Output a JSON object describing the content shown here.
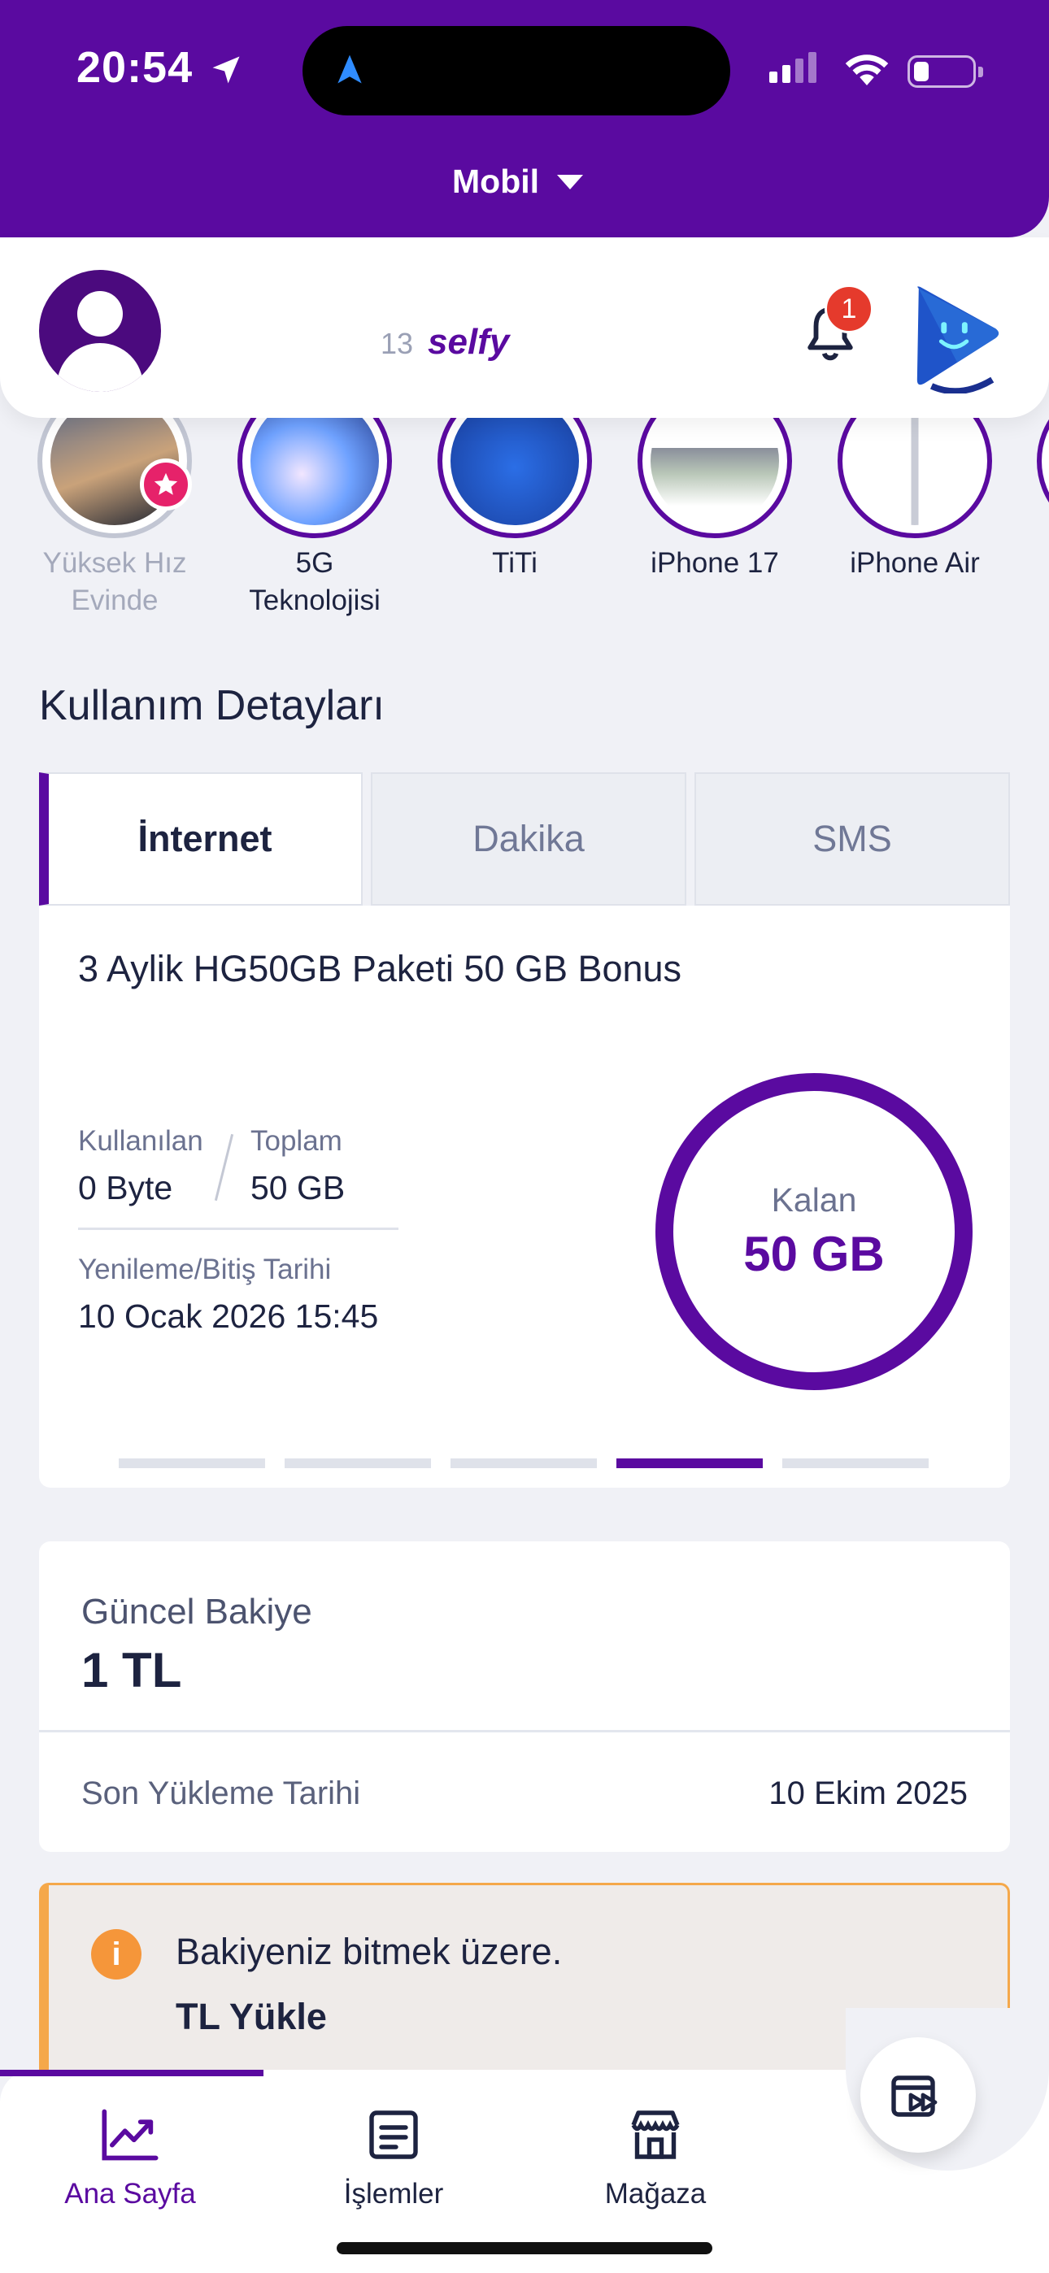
{
  "status_bar": {
    "time": "20:54"
  },
  "header": {
    "line_selector": "Mobil"
  },
  "profile": {
    "name_suffix": "13",
    "brand": "selfy",
    "notification_count": "1"
  },
  "stories": [
    {
      "label": "Yüksek Hız Evinde",
      "seen": true
    },
    {
      "label": "5G Teknolojisi",
      "seen": false
    },
    {
      "label": "TiTi",
      "seen": false
    },
    {
      "label": "iPhone 17",
      "seen": false
    },
    {
      "label": "iPhone Air",
      "seen": false
    }
  ],
  "usage": {
    "title": "Kullanım Detayları",
    "tabs": [
      "İnternet",
      "Dakika",
      "SMS"
    ],
    "active_tab": "İnternet",
    "package_name": "3 Aylik HG50GB Paketi 50 GB Bonus",
    "used_label": "Kullanılan",
    "used_value": "0 Byte",
    "total_label": "Toplam",
    "total_value": "50 GB",
    "renewal_label": "Yenileme/Bitiş Tarihi",
    "renewal_value": "10 Ocak 2026 15:45",
    "remaining_label": "Kalan",
    "remaining_value": "50 GB",
    "remaining_fraction": 1.0,
    "pager": {
      "count": 5,
      "active_index": 3
    }
  },
  "balance": {
    "label": "Güncel Bakiye",
    "value": "1 TL",
    "last_topup_label": "Son Yükleme Tarihi",
    "last_topup_value": "10 Ekim 2025"
  },
  "warning": {
    "icon": "info-icon",
    "message": "Bakiyeniz bitmek üzere.",
    "action": "TL Yükle"
  },
  "bottom_nav": [
    {
      "label": "Ana Sayfa",
      "icon": "chart-icon",
      "active": true
    },
    {
      "label": "İşlemler",
      "icon": "receipt-icon",
      "active": false
    },
    {
      "label": "Mağaza",
      "icon": "store-icon",
      "active": false
    }
  ],
  "colors": {
    "brand": "#5a0aa0",
    "warning": "#f5a84a",
    "badge": "#e53a2c"
  }
}
